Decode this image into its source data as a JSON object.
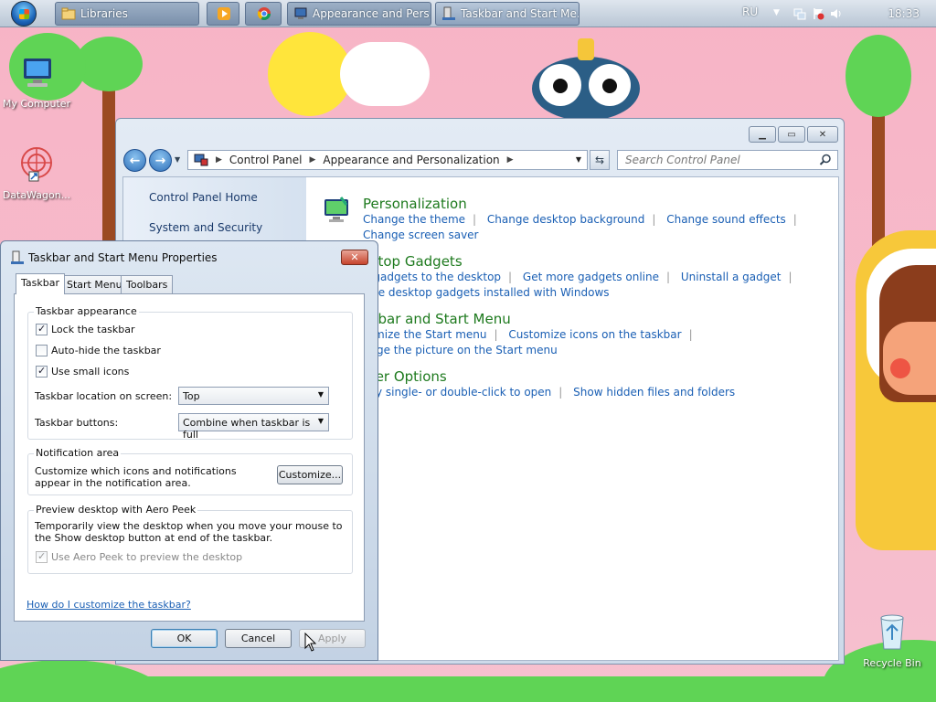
{
  "taskbar": {
    "buttons": [
      {
        "label": "Libraries"
      },
      {
        "label": "Appearance and Pers..."
      },
      {
        "label": "Taskbar and Start Me..."
      }
    ],
    "tray": {
      "language": "RU",
      "clock": "18:33"
    }
  },
  "desktop": {
    "icons": [
      {
        "label": "My Computer"
      },
      {
        "label": "DataWagon..."
      },
      {
        "label": "Recycle Bin"
      }
    ]
  },
  "control_panel": {
    "address": {
      "root": "Control Panel",
      "current": "Appearance and Personalization"
    },
    "search_placeholder": "Search Control Panel",
    "sidebar": [
      {
        "label": "Control Panel Home"
      },
      {
        "label": "System and Security"
      }
    ],
    "categories": [
      {
        "title": "Personalization",
        "links": [
          "Change the theme",
          "Change desktop background",
          "Change sound effects",
          "Change screen saver"
        ]
      },
      {
        "title": "sktop Gadgets",
        "links": [
          "d gadgets to the desktop",
          "Get more gadgets online",
          "Uninstall a gadget",
          "tore desktop gadgets installed with Windows"
        ]
      },
      {
        "title": "skbar and Start Menu",
        "links": [
          "tomize the Start menu",
          "Customize icons on the taskbar",
          "ange the picture on the Start menu"
        ]
      },
      {
        "title": "lder Options",
        "links": [
          "cify single- or double-click to open",
          "Show hidden files and folders"
        ]
      }
    ]
  },
  "dialog": {
    "title": "Taskbar and Start Menu Properties",
    "tabs": [
      "Taskbar",
      "Start Menu",
      "Toolbars"
    ],
    "taskbar_appearance": {
      "label": "Taskbar appearance",
      "lock": {
        "label": "Lock the taskbar",
        "checked": true
      },
      "autohide": {
        "label": "Auto-hide the taskbar",
        "checked": false
      },
      "small_icons": {
        "label": "Use small icons",
        "checked": true
      },
      "location_label": "Taskbar location on screen:",
      "location_value": "Top",
      "buttons_label": "Taskbar buttons:",
      "buttons_value": "Combine when taskbar is full"
    },
    "notification": {
      "label": "Notification area",
      "desc": "Customize which icons and notifications appear in the notification area.",
      "button": "Customize..."
    },
    "aero_peek": {
      "label": "Preview desktop with Aero Peek",
      "desc": "Temporarily view the desktop when you move your mouse to the Show desktop button at end of the taskbar.",
      "checkbox": {
        "label": "Use Aero Peek to preview the desktop",
        "checked": true
      }
    },
    "help_link": "How do I customize the taskbar?",
    "buttons": {
      "ok": "OK",
      "cancel": "Cancel",
      "apply": "Apply"
    }
  }
}
